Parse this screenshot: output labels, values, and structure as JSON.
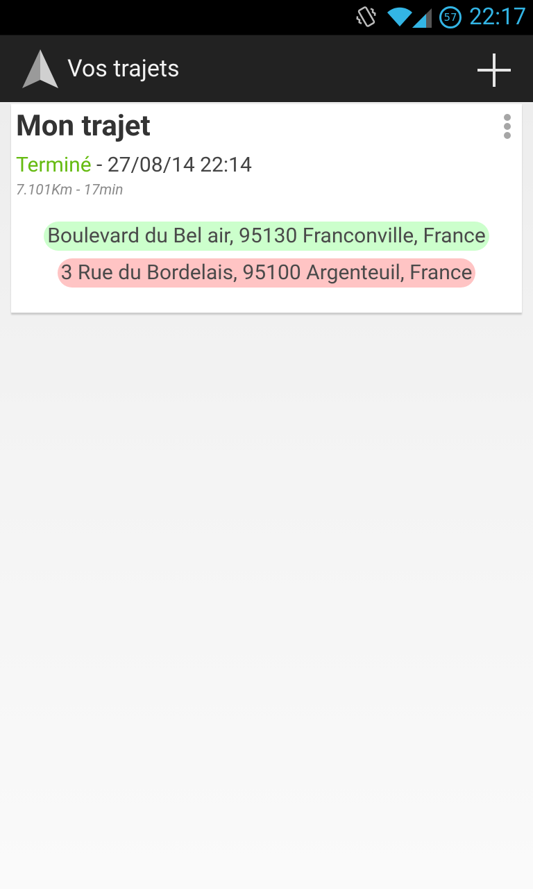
{
  "status_bar": {
    "time": "22:17",
    "battery_level": "57",
    "icons": [
      "vibrate-icon",
      "wifi-icon",
      "signal-icon",
      "battery-icon"
    ],
    "accent_color": "#33b5e5"
  },
  "action_bar": {
    "title": "Vos trajets",
    "app_icon": "navigation-arrow-icon",
    "add_icon": "plus-icon"
  },
  "trips": [
    {
      "title": "Mon trajet",
      "status": "Terminé",
      "status_color": "#66bb11",
      "date_text": " - 27/08/14 22:14",
      "stats": "7.101Km - 17min",
      "start_address": "Boulevard du Bel air, 95130 Franconville, France",
      "end_address": "3 Rue du Bordelais, 95100 Argenteuil, France",
      "menu_icon": "overflow-menu-icon"
    }
  ]
}
